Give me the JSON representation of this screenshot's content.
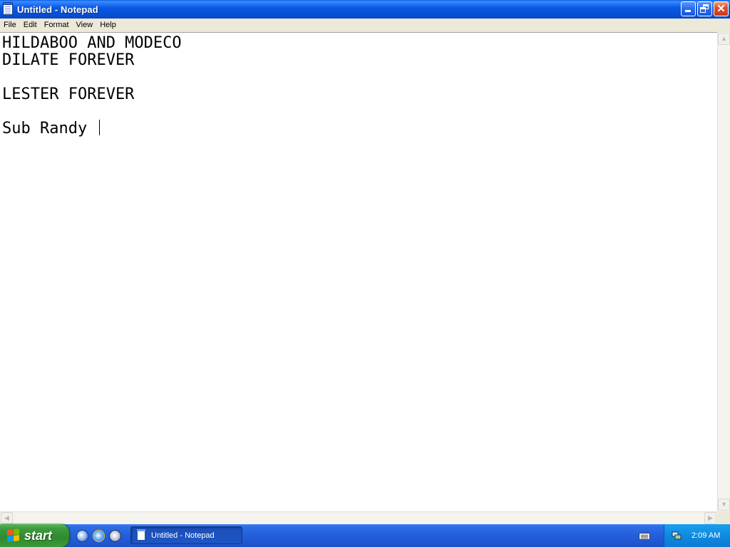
{
  "window": {
    "title": "Untitled - Notepad",
    "icon": "notepad-icon"
  },
  "menu": {
    "items": [
      "File",
      "Edit",
      "Format",
      "View",
      "Help"
    ]
  },
  "document": {
    "lines": [
      "HILDABOO AND MODECO",
      "DILATE FOREVER",
      "",
      "LESTER FOREVER",
      "",
      "Sub Randy "
    ]
  },
  "taskbar": {
    "start_label": "start",
    "quick_launch": [
      "email-icon",
      "internet-explorer-icon",
      "media-player-icon"
    ],
    "task_button_label": "Untitled - Notepad",
    "clock": "2:09 AM"
  },
  "colors": {
    "titlebar": "#0b59e6",
    "menubar": "#ece9d8",
    "taskbar": "#245edb",
    "start_button": "#3c9a3c",
    "tray": "#0f8ae0"
  }
}
